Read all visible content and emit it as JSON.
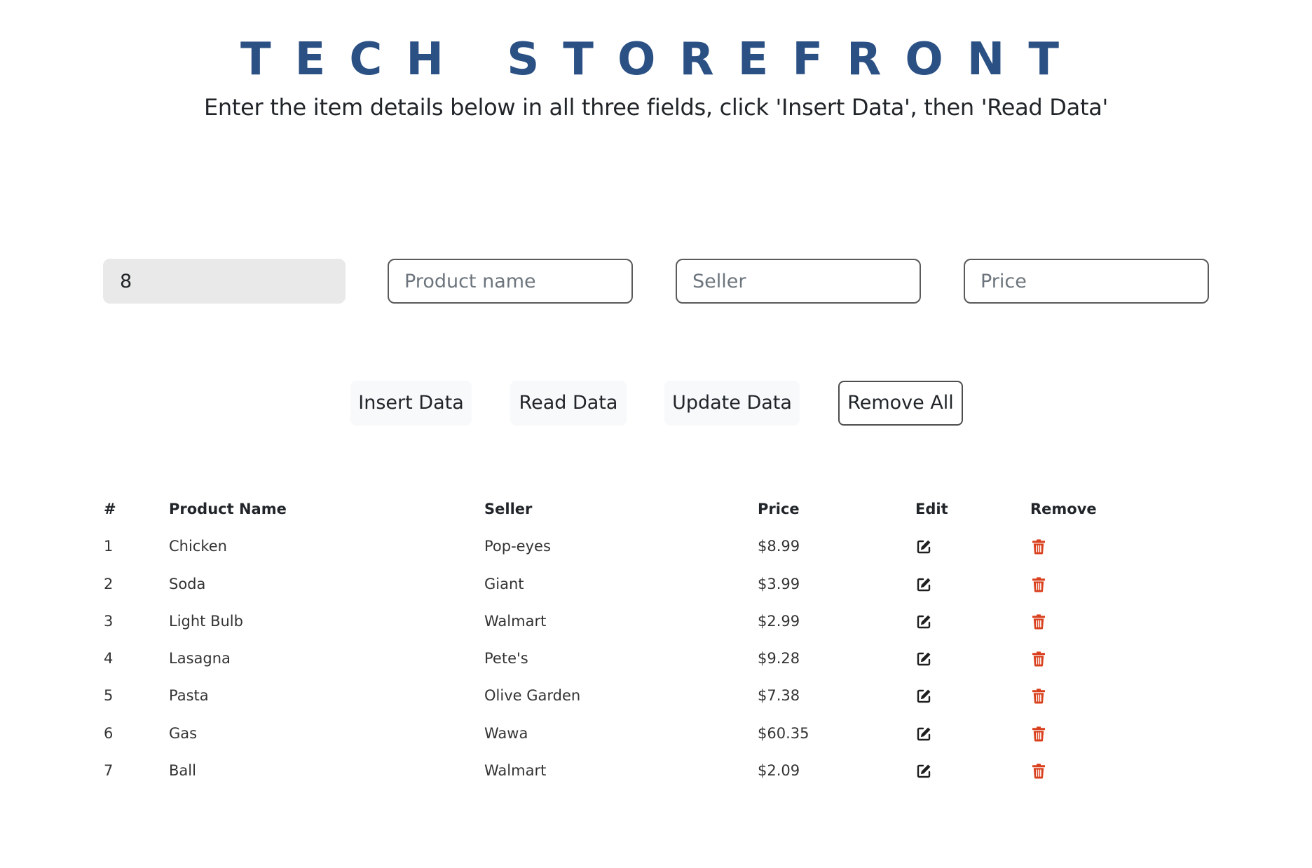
{
  "header": {
    "title": "TECH STOREFRONT",
    "subtitle": "Enter the item details below in all three fields, click 'Insert Data', then 'Read Data'"
  },
  "form": {
    "id_value": "8",
    "product_placeholder": "Product name",
    "seller_placeholder": "Seller",
    "price_placeholder": "Price"
  },
  "buttons": {
    "insert": "Insert Data",
    "read": "Read Data",
    "update": "Update Data",
    "remove_all": "Remove All"
  },
  "table": {
    "columns": [
      "#",
      "Product Name",
      "Seller",
      "Price",
      "Edit",
      "Remove"
    ],
    "rows": [
      {
        "num": "1",
        "name": "Chicken",
        "seller": "Pop-eyes",
        "price": "$8.99"
      },
      {
        "num": "2",
        "name": "Soda",
        "seller": "Giant",
        "price": "$3.99"
      },
      {
        "num": "3",
        "name": "Light Bulb",
        "seller": "Walmart",
        "price": "$2.99"
      },
      {
        "num": "4",
        "name": "Lasagna",
        "seller": "Pete's",
        "price": "$9.28"
      },
      {
        "num": "5",
        "name": "Pasta",
        "seller": "Olive Garden",
        "price": "$7.38"
      },
      {
        "num": "6",
        "name": "Gas",
        "seller": "Wawa",
        "price": "$60.35"
      },
      {
        "num": "7",
        "name": "Ball",
        "seller": "Walmart",
        "price": "$2.09"
      }
    ],
    "edit_icon": "edit-icon",
    "remove_icon": "trash-icon"
  },
  "colors": {
    "title": "#2b5084",
    "trash": "#d9411e",
    "id_field_bg": "#e9e9e9"
  }
}
